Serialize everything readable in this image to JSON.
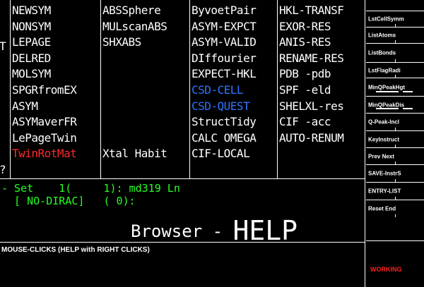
{
  "grid": {
    "left_marks": {
      "lepage": "T",
      "twinrotmat": "?"
    },
    "col1": [
      "NEWSYM",
      "NONSYM",
      "LEPAGE",
      "DELRED",
      "MOLSYM",
      "SPGRfromEX",
      "ASYM",
      "ASYMaverFR",
      "LePageTwin",
      "TwinRotMat"
    ],
    "col2": [
      "ABSSphere",
      "MULscanABS",
      "SHXABS",
      "",
      "",
      "",
      "",
      "",
      "",
      "Xtal Habit"
    ],
    "col3": [
      "ByvoetPair",
      "ASYM-EXPCT",
      "ASYM-VALID",
      "DIffourier",
      "EXPECT-HKL",
      "CSD-CELL",
      "CSD-QUEST",
      "StructTidy",
      "CALC OMEGA",
      "CIF-LOCAL"
    ],
    "col4": [
      "HKL-TRANSF",
      "EXOR-RES",
      "ANIS-RES",
      "RENAME-RES",
      "PDB    -pdb",
      "SPF    -eld",
      "SHELXL-res",
      "CIF    -acc",
      "AUTO-RENUM",
      ""
    ]
  },
  "colors": {
    "background": "#000000",
    "text": "#ffffff",
    "highlight_blue": "#2f74ff",
    "highlight_red": "#ff2a2a",
    "status_green": "#26ff26"
  },
  "right_panel": {
    "buttons": [
      {
        "id": "lst-cell-symm",
        "label": "LstCellSymm"
      },
      {
        "id": "list-atoms",
        "label": "ListAtoms"
      },
      {
        "id": "list-bonds",
        "label": "ListBonds"
      },
      {
        "id": "lst-flag-radi",
        "label": "LstFlagRadi"
      },
      {
        "id": "min-q-peak-hgt",
        "label": "MinQPeakHgt"
      },
      {
        "id": "min-q-peak-dis",
        "label": "MinQPeakDis"
      },
      {
        "id": "q-peak-incl",
        "label": "Q-Peak-Incl"
      },
      {
        "id": "key-instruct",
        "label": "KeyInstruct"
      },
      {
        "id": "prev-next",
        "label": "Prev   Next"
      },
      {
        "id": "save-instrs",
        "label": "SAVE-InstrS"
      },
      {
        "id": "entry-list",
        "label": "ENTRY-LIST"
      },
      {
        "id": "reset-end",
        "label": "Reset   End"
      }
    ],
    "status": "WORKING"
  },
  "status_area": {
    "line1": "- Set    1(     1): md319 Ln",
    "line2": "  [ NO-DIRAC]   ( 0):",
    "browser_title": "Browser - HELP",
    "hint": "MOUSE-CLICKS (HELP with RIGHT CLICKS)"
  }
}
